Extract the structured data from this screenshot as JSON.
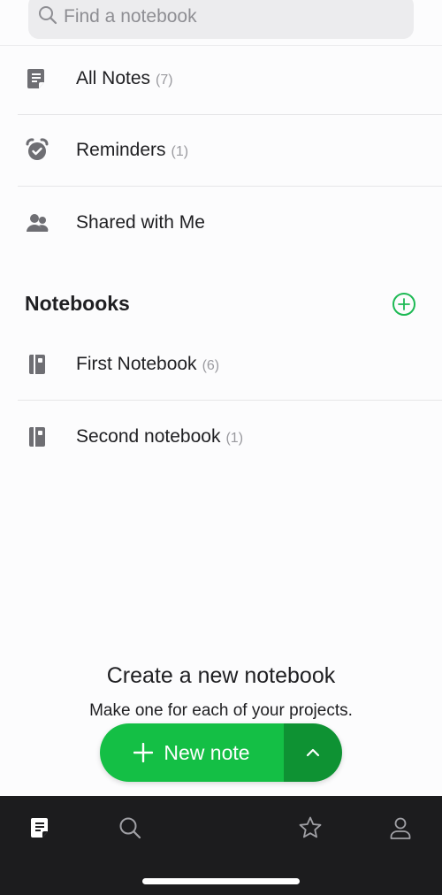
{
  "search": {
    "placeholder": "Find a notebook"
  },
  "shortcuts": [
    {
      "label": "All Notes",
      "count": "(7)",
      "icon": "note-icon"
    },
    {
      "label": "Reminders",
      "count": "(1)",
      "icon": "alarm-clock-icon"
    },
    {
      "label": "Shared with Me",
      "count": "",
      "icon": "people-icon"
    }
  ],
  "notebooks_section": {
    "title": "Notebooks",
    "add_icon": "plus-circle-icon",
    "items": [
      {
        "label": "First Notebook",
        "count": "(6)",
        "icon": "notebook-icon"
      },
      {
        "label": "Second notebook",
        "count": "(1)",
        "icon": "notebook-icon"
      }
    ]
  },
  "empty_state": {
    "title": "Create a new notebook",
    "subtitle": "Make one for each of your projects."
  },
  "new_note_button": {
    "label": "New note",
    "plus_icon": "plus-icon",
    "more_icon": "chevron-up-icon"
  },
  "tabbar": [
    {
      "name": "notes-tab",
      "icon": "note-icon",
      "active": true
    },
    {
      "name": "search-tab",
      "icon": "search-icon",
      "active": false
    },
    {
      "name": "shortcuts-tab",
      "icon": "star-icon",
      "active": false
    },
    {
      "name": "account-tab",
      "icon": "person-icon",
      "active": false
    }
  ],
  "colors": {
    "accent": "#14bf45",
    "accent_dark": "#0e9233",
    "icon_gray": "#6e6e73",
    "tabbar_bg": "#1c1c1e",
    "background": "#fcfcfd"
  }
}
